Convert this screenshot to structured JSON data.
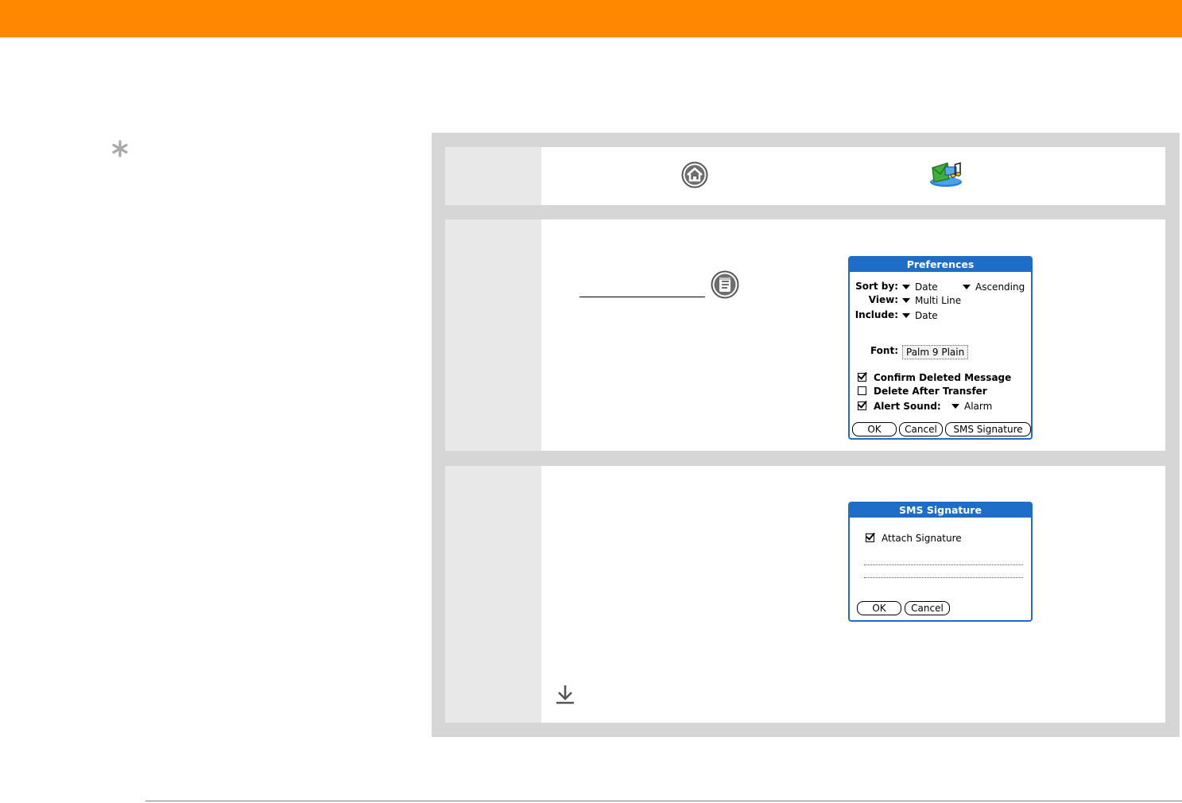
{
  "pref": {
    "title": "Preferences",
    "sort_label": "Sort by:",
    "sort_value": "Date",
    "order_value": "Ascending",
    "view_label": "View:",
    "view_value": "Multi Line",
    "include_label": "Include:",
    "include_value": "Date",
    "font_label": "Font:",
    "font_value": "Palm 9 Plain",
    "confirm_label": "Confirm Deleted Message",
    "confirm_checked": true,
    "delete_label": "Delete After Transfer",
    "delete_checked": false,
    "alert_label": "Alert Sound:",
    "alert_checked": true,
    "alert_value": "Alarm",
    "ok": "OK",
    "cancel": "Cancel",
    "sms_signature": "SMS Signature"
  },
  "sig": {
    "title": "SMS Signature",
    "attach_label": "Attach Signature",
    "attach_checked": true,
    "ok": "OK",
    "cancel": "Cancel"
  },
  "icons": {
    "tip": "asterisk-icon",
    "home": "home-icon",
    "app": "messaging-app-icon",
    "menu": "menu-icon",
    "done": "download-arrow-icon"
  },
  "colors": {
    "header": "#ff8800",
    "palm_title": "#1e6ec8"
  }
}
